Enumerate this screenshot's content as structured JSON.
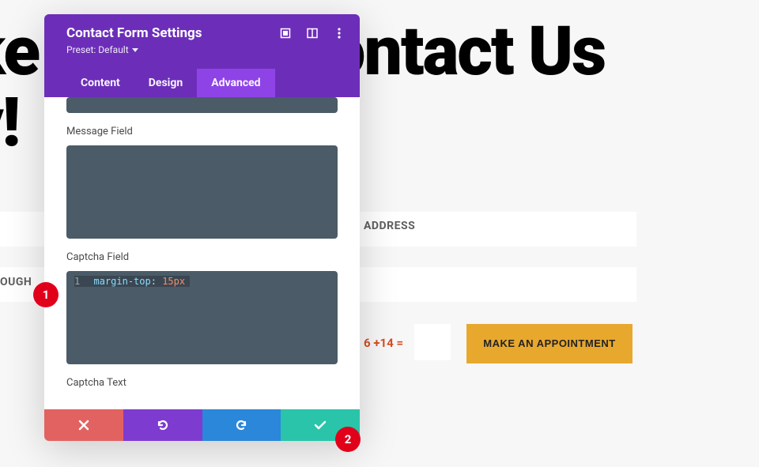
{
  "page": {
    "heading_line1": "ke",
    "heading_line2": "y!",
    "heading_right": "Contact Us",
    "address_label": "ADDRESS",
    "ough_label": "OUGH",
    "captcha_eq": "6 +14 =",
    "appointment_btn": "MAKE AN APPOINTMENT"
  },
  "panel": {
    "title": "Contact Form Settings",
    "preset_label": "Preset: Default",
    "tabs": {
      "content": "Content",
      "design": "Design",
      "advanced": "Advanced"
    },
    "fields": {
      "message_label": "Message Field",
      "captcha_field_label": "Captcha Field",
      "captcha_field_code": {
        "line_num": "1",
        "prop": "margin-top",
        "colon": ":",
        "val": "15px"
      },
      "captcha_text_label": "Captcha Text"
    }
  },
  "callouts": {
    "one": "1",
    "two": "2"
  }
}
